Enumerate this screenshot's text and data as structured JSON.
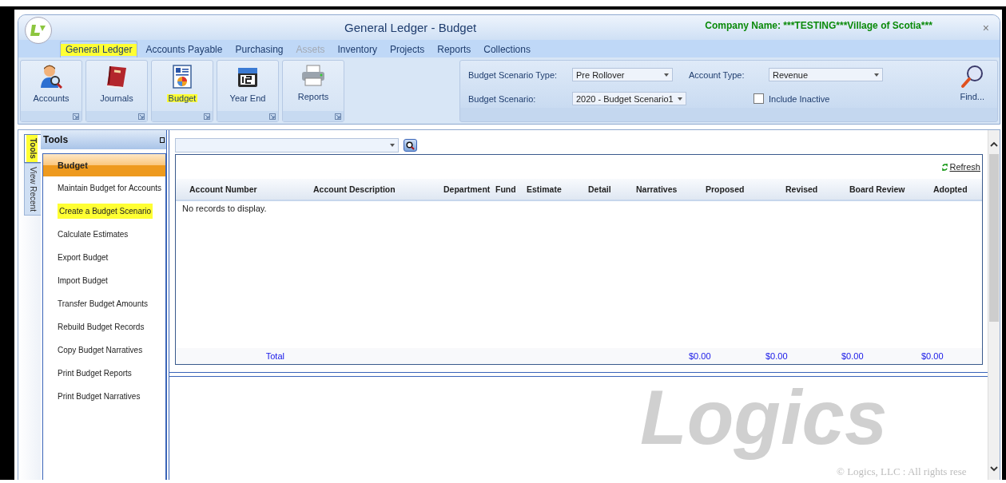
{
  "window": {
    "title": "General Ledger - Budget",
    "company": "Company Name: ***TESTING***Village of Scotia***",
    "close": "×"
  },
  "menu_tabs": [
    {
      "label": "General Ledger",
      "selected": true,
      "disabled": false,
      "highlighted": true
    },
    {
      "label": "Accounts Payable",
      "selected": false,
      "disabled": false,
      "highlighted": false
    },
    {
      "label": "Purchasing",
      "selected": false,
      "disabled": false,
      "highlighted": false
    },
    {
      "label": "Assets",
      "selected": false,
      "disabled": true,
      "highlighted": false
    },
    {
      "label": "Inventory",
      "selected": false,
      "disabled": false,
      "highlighted": false
    },
    {
      "label": "Projects",
      "selected": false,
      "disabled": false,
      "highlighted": false
    },
    {
      "label": "Reports",
      "selected": false,
      "disabled": false,
      "highlighted": false
    },
    {
      "label": "Collections",
      "selected": false,
      "disabled": false,
      "highlighted": false
    }
  ],
  "ribbon": [
    {
      "label": "Accounts",
      "kind": "person",
      "highlighted": false
    },
    {
      "label": "Journals",
      "kind": "book",
      "highlighted": false
    },
    {
      "label": "Budget",
      "kind": "report",
      "highlighted": true
    },
    {
      "label": "Year End",
      "kind": "calendar",
      "highlighted": false
    },
    {
      "label": "Reports",
      "kind": "printer",
      "highlighted": false
    }
  ],
  "filters": {
    "scenario_type_label": "Budget Scenario Type:",
    "scenario_type": "Pre Rollover",
    "account_type_label": "Account Type:",
    "account_type": "Revenue",
    "scenario_label": "Budget Scenario:",
    "scenario": "2020 - Budget Scenario1",
    "include_inactive": {
      "label": "Include Inactive",
      "checked": false
    },
    "find": "Find..."
  },
  "side_tabs": [
    {
      "label": "Tools",
      "selected": true,
      "highlighted": true
    },
    {
      "label": "View Recent",
      "selected": false,
      "highlighted": false
    }
  ],
  "tools": {
    "title": "Tools",
    "section": "Budget",
    "items": [
      {
        "label": "Maintain Budget for Accounts",
        "highlighted": false
      },
      {
        "label": "Create a Budget Scenario",
        "highlighted": true
      },
      {
        "label": "Calculate Estimates",
        "highlighted": false
      },
      {
        "label": "Export Budget",
        "highlighted": false
      },
      {
        "label": "Import Budget",
        "highlighted": false
      },
      {
        "label": "Transfer Budget Amounts",
        "highlighted": false
      },
      {
        "label": "Rebuild Budget Records",
        "highlighted": false
      },
      {
        "label": "Copy Budget Narratives",
        "highlighted": false
      },
      {
        "label": "Print Budget Reports",
        "highlighted": false
      },
      {
        "label": "Print Budget Narratives",
        "highlighted": false
      }
    ]
  },
  "grid": {
    "refresh": "Refresh",
    "empty_message": "No records to display.",
    "columns": [
      {
        "label": "Account Number",
        "total": "Total"
      },
      {
        "label": "Account Description"
      },
      {
        "label": "Department"
      },
      {
        "label": "Fund"
      },
      {
        "label": "Estimate"
      },
      {
        "label": "Detail"
      },
      {
        "label": "Narratives"
      },
      {
        "label": "Proposed",
        "total": "$0.00"
      },
      {
        "label": "Revised",
        "total": "$0.00"
      },
      {
        "label": "Board Review",
        "total": "$0.00"
      },
      {
        "label": "Adopted",
        "total": "$0.00"
      }
    ]
  },
  "branding": {
    "logo_text": "Logics",
    "copyright": "© Logics, LLC : All rights rese"
  }
}
